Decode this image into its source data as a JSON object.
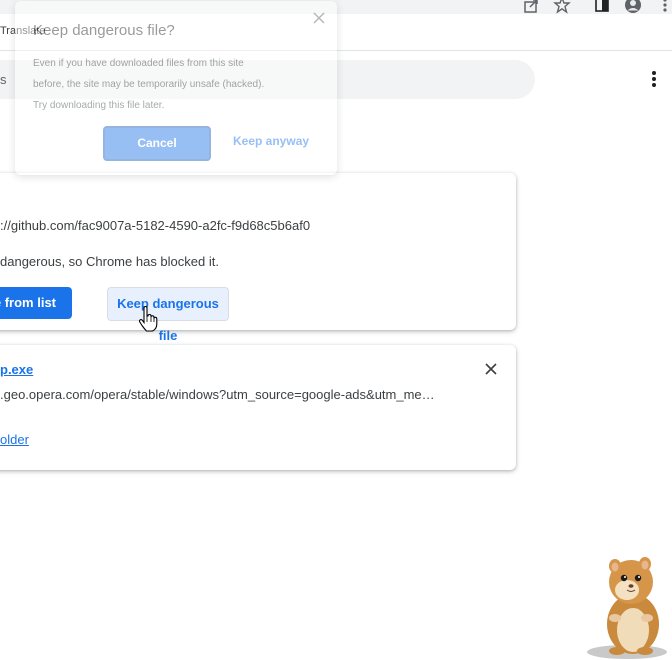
{
  "toolbar": {
    "bookmark_translate": "Translate",
    "icons": [
      "share-icon",
      "star-icon",
      "side-panel-icon",
      "profile-icon",
      "menu-icon"
    ]
  },
  "search": {
    "prefix": "s"
  },
  "downloads": [
    {
      "url": "://github.com/fac9007a-5182-4590-a2fc-f9d68c5b6af0",
      "warning": "dangerous, so Chrome has blocked it.",
      "remove_label": "e from list",
      "keep_label": "Keep dangerous file"
    },
    {
      "filename": "p.exe",
      "url": ".geo.opera.com/opera/stable/windows?utm_source=google-ads&utm_me…",
      "show_folder": "older"
    }
  ],
  "dialog": {
    "title": "Keep dangerous file?",
    "body_lines": [
      "Even if you have downloaded files from this site",
      "before, the site may be temporarily unsafe (hacked).",
      "Try downloading this file later."
    ],
    "cancel_label": "Cancel",
    "keep_label": "Keep anyway"
  },
  "colors": {
    "accent": "#1a73e8",
    "keep_button_bg": "#e8f0fe",
    "search_bg": "#f1f3f4"
  }
}
